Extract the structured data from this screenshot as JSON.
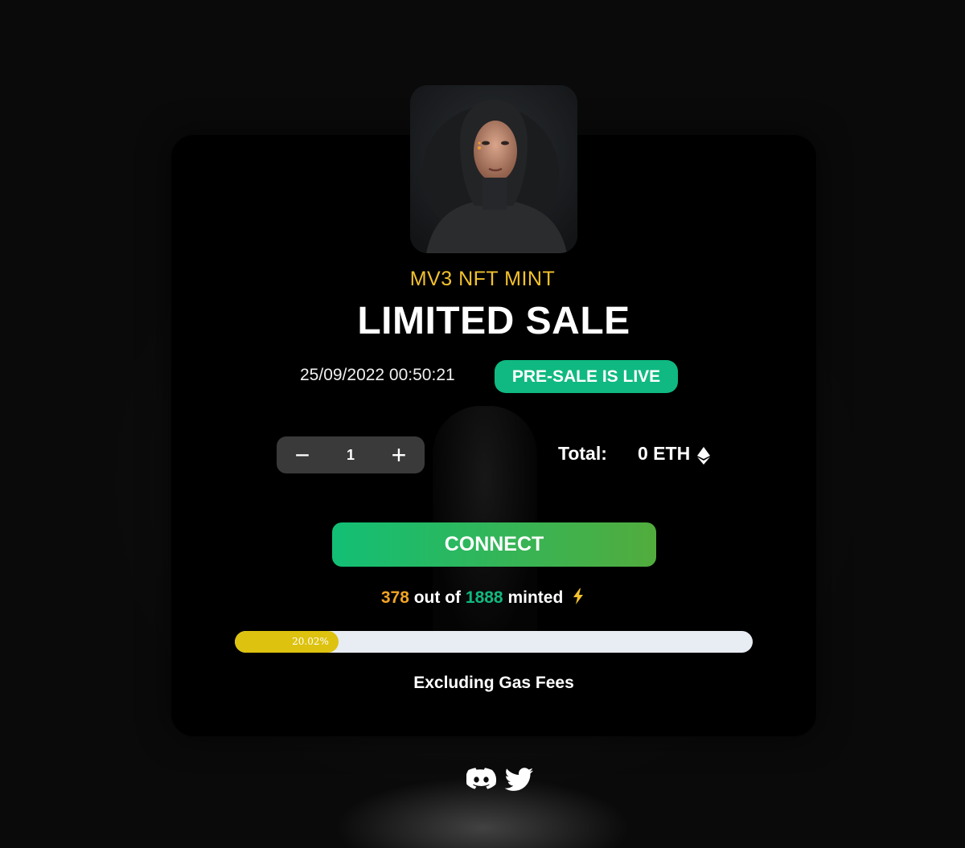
{
  "header": {
    "subtitle": "MV3 NFT MINT",
    "title": "LIMITED SALE"
  },
  "sale": {
    "date": "25/09/2022 00:50:21",
    "status": "PRE-SALE IS LIVE"
  },
  "stepper": {
    "minus": "−",
    "quantity": "1",
    "plus": "+"
  },
  "total": {
    "label": "Total:",
    "value": "0 ETH"
  },
  "connect_button": "CONNECT",
  "mint_progress": {
    "minted": "378",
    "separator": "out of",
    "supply": "1888",
    "suffix": "minted",
    "percent_label": "20.02%",
    "percent": 20.02
  },
  "footnote": "Excluding Gas Fees",
  "socials": [
    "discord-icon",
    "twitter-icon"
  ],
  "colors": {
    "accent_yellow": "#f2c12e",
    "badge_green": "#10b981",
    "minted_orange": "#f0a425",
    "progress_fill": "#ddc20f",
    "progress_track": "#e8ecf3"
  }
}
